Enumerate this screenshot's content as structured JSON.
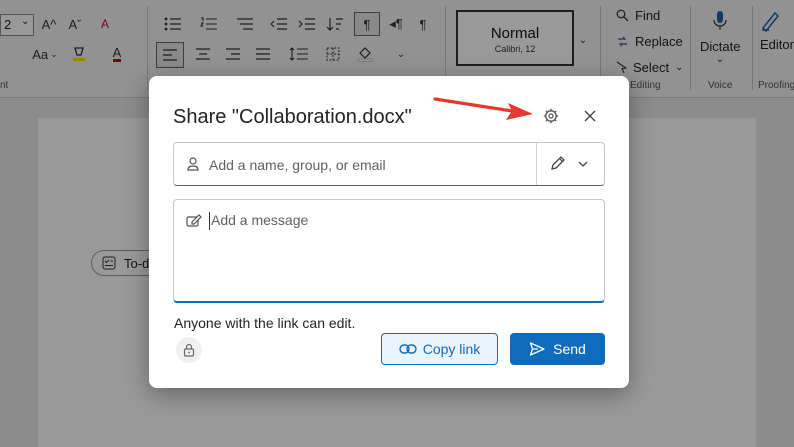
{
  "ribbon": {
    "font_size": "2",
    "grow_font": "A^",
    "shrink_font": "Aˇ",
    "change_case": "Aa",
    "clear_format": "A",
    "font_color_label": "A",
    "style_name": "Normal",
    "style_font": "Calibri, 12",
    "find": "Find",
    "replace": "Replace",
    "select": "Select",
    "dictate": "Dictate",
    "editor": "Editor",
    "group_font": "nt",
    "group_editing": "Editing",
    "group_voice": "Voice",
    "group_proofing": "Proofing"
  },
  "document": {
    "todo_label": "To-d"
  },
  "dialog": {
    "title": "Share \"Collaboration.docx\"",
    "to_placeholder": "Add a name, group, or email",
    "message_placeholder": "Add a message",
    "link_info": "Anyone with the link can edit.",
    "copy_link": "Copy link",
    "send": "Send"
  },
  "colors": {
    "accent": "#0f6cbd",
    "annotation_arrow": "#e8372c"
  }
}
